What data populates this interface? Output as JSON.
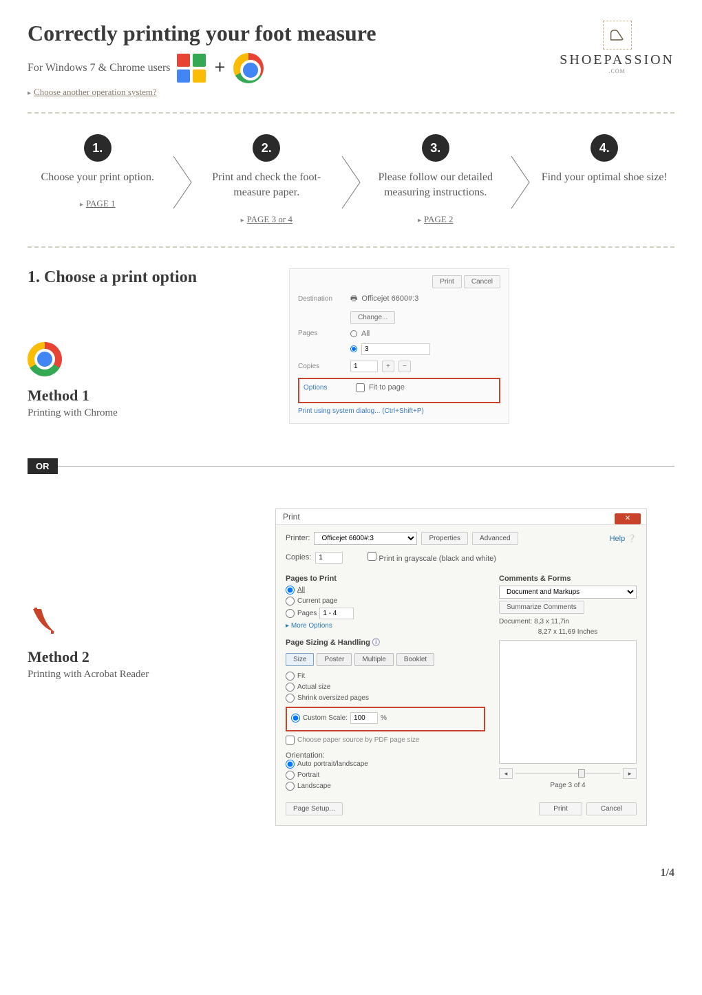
{
  "header": {
    "title": "Correctly printing your foot measure",
    "subtitle": "For Windows 7 & Chrome users",
    "choose_os_link": "Choose another operation system?",
    "brand": "SHOEPASSION",
    "brand_sub": ".COM"
  },
  "steps": [
    {
      "badge": "1.",
      "text": "Choose your print option.",
      "link": "PAGE 1"
    },
    {
      "badge": "2.",
      "text": "Print and check the foot-measure paper.",
      "link": "PAGE 3 or 4"
    },
    {
      "badge": "3.",
      "text": "Please follow our detailed measuring instructions.",
      "link": "PAGE 2"
    },
    {
      "badge": "4.",
      "text": "Find your optimal shoe size!",
      "link": ""
    }
  ],
  "section1": {
    "title": "1. Choose a print option"
  },
  "method1": {
    "name": "Method 1",
    "desc": "Printing with Chrome",
    "screenshot": {
      "print_btn": "Print",
      "cancel_btn": "Cancel",
      "destination_label": "Destination",
      "destination_value": "Officejet 6600#:3",
      "change_btn": "Change...",
      "pages_label": "Pages",
      "pages_all": "All",
      "pages_value": "3",
      "copies_label": "Copies",
      "copies_value": "1",
      "options_label": "Options",
      "fit_to_page": "Fit to page",
      "system_dialog": "Print using system dialog... (Ctrl+Shift+P)"
    }
  },
  "or_label": "OR",
  "method2": {
    "name": "Method 2",
    "desc": "Printing with Acrobat Reader",
    "screenshot": {
      "title": "Print",
      "printer_label": "Printer:",
      "printer_value": "Officejet 6600#:3",
      "properties_btn": "Properties",
      "advanced_btn": "Advanced",
      "help_link": "Help",
      "copies_label": "Copies:",
      "copies_value": "1",
      "grayscale": "Print in grayscale (black and white)",
      "pages_to_print": "Pages to Print",
      "opt_all": "All",
      "opt_current": "Current page",
      "opt_pages": "Pages",
      "opt_pages_value": "1 - 4",
      "more_options": "More Options",
      "sizing_title": "Page Sizing & Handling",
      "tab_size": "Size",
      "tab_poster": "Poster",
      "tab_multiple": "Multiple",
      "tab_booklet": "Booklet",
      "fit": "Fit",
      "actual_size": "Actual size",
      "shrink": "Shrink oversized pages",
      "custom_scale": "Custom Scale:",
      "custom_scale_value": "100",
      "custom_scale_pct": "%",
      "choose_paper": "Choose paper source by PDF page size",
      "orientation": "Orientation:",
      "auto": "Auto portrait/landscape",
      "portrait": "Portrait",
      "landscape": "Landscape",
      "comments_forms": "Comments & Forms",
      "doc_markups": "Document and Markups",
      "summarize_btn": "Summarize Comments",
      "doc_size": "Document: 8,3 x 11,7in",
      "preview_size": "8,27 x 11,69 Inches",
      "page_label": "Page 3 of 4",
      "page_setup_btn": "Page Setup...",
      "print_btn": "Print",
      "cancel_btn": "Cancel"
    }
  },
  "page_number": "1/4"
}
